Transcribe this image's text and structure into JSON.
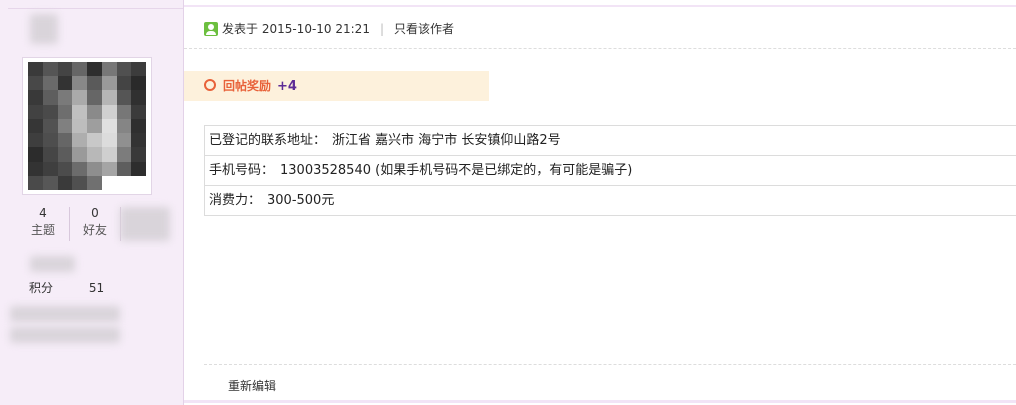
{
  "user": {
    "avatar_label": "user avatar",
    "stats": [
      {
        "value": "4",
        "label": "主题"
      },
      {
        "value": "0",
        "label": "好友"
      }
    ],
    "points_label": "积分",
    "points_value": "51"
  },
  "post": {
    "posted_at": "发表于 2015-10-10 21:21",
    "meta_separator": "|",
    "author_only_link": "只看该作者",
    "reward_label": "回帖奖励",
    "reward_value": "+4",
    "info_rows": [
      {
        "key": "已登记的联系地址：",
        "value": "浙江省 嘉兴市 海宁市 长安镇仰山路2号"
      },
      {
        "key": "手机号码：",
        "value": "13003528540  (如果手机号码不是已绑定的，有可能是骗子)"
      },
      {
        "key": "消费力：",
        "value": "300-500元"
      }
    ],
    "edit_link": "重新编辑"
  },
  "colors": {
    "sidebar_bg": "#f6edf8",
    "reward_bg": "#fdf1dc",
    "reward_label": "#e8623a",
    "reward_value": "#5d2b96",
    "post_icon": "#6cbf3f"
  }
}
